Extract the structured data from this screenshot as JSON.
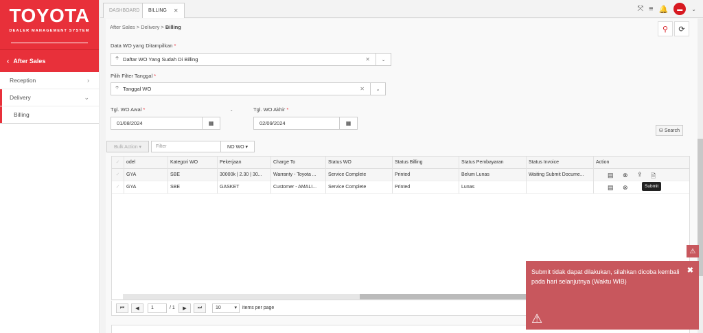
{
  "brand": {
    "logo": "TOYOTA",
    "subtitle": "DEALER MANAGEMENT SYSTEM"
  },
  "sidebar": {
    "module": "After Sales",
    "items": [
      {
        "label": "Reception"
      },
      {
        "label": "Delivery"
      },
      {
        "label": "Billing"
      }
    ]
  },
  "tabs": [
    {
      "label": "DASHBOARD"
    },
    {
      "label": "BILLING"
    }
  ],
  "breadcrumb": {
    "a": "After Sales",
    "b": "Delivery",
    "c": "Billing"
  },
  "form": {
    "wo_label": "Data WO yang Ditampilkan",
    "wo_value": "Daftar WO Yang Sudah Di Billing",
    "filter_label": "Pilih Filter Tanggal",
    "filter_value": "Tanggal WO",
    "start_label": "Tgl. WO Awal",
    "end_label": "Tgl. WO Akhir",
    "dash": "-",
    "start_value": "01/08/2024",
    "end_value": "02/09/2024",
    "search_label": "Search"
  },
  "toolbar": {
    "bulk_label": "Bulk Action ▾",
    "filter_placeholder": "Filter",
    "nowo_label": "NO WO ▾"
  },
  "grid": {
    "columns": [
      "odel",
      "Kategori WO",
      "Pekerjaan",
      "Charge To",
      "Status WO",
      "Status Billing",
      "Status Pembayaran",
      "Status Invoice",
      "Action"
    ],
    "rows": [
      [
        "GYA",
        "SBE",
        "30000k | 2.30 | 30...",
        "Warranty - Toyota ...",
        "Service Complete",
        "Printed",
        "Belum Lunas",
        "Waiting Submit Docume..."
      ],
      [
        "GYA",
        "SBE",
        "GASKET",
        "Customer - AMALI...",
        "Service Complete",
        "Printed",
        "Lunas",
        ""
      ]
    ],
    "tooltip": "Submit"
  },
  "pager": {
    "page": "1",
    "of": "/ 1",
    "per_page": "10",
    "per_page_label": "items per page"
  },
  "toast": {
    "message": "Submit tidak dapat dilakukan, silahkan dicoba kembali pada hari selanjutnya (Waktu WIB)"
  }
}
